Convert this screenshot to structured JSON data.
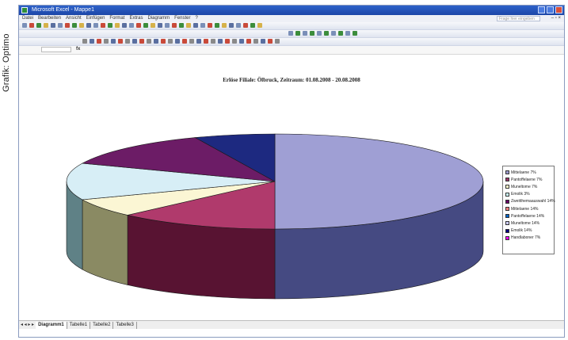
{
  "caption": "Grafik: Optimo",
  "window": {
    "title": "Microsoft Excel - Mappe1"
  },
  "menu": {
    "items": [
      "Datei",
      "Bearbeiten",
      "Ansicht",
      "Einfügen",
      "Format",
      "Extras",
      "Diagramm",
      "Fenster",
      "?"
    ],
    "help_placeholder": "Frage hier eingeben"
  },
  "chart_data": {
    "type": "pie",
    "title": "Erlöse Filiale: Ölbruck, Zeitraum: 01.08.2008 - 20.08.2008",
    "slices": [
      {
        "label": "Mittelaene 7%",
        "value": 7,
        "color": "#9999cc"
      },
      {
        "label": "Pantoffelaene 7%",
        "value": 7,
        "color": "#993366"
      },
      {
        "label": "Muneltome 7%",
        "value": 7,
        "color": "#ffffcc"
      },
      {
        "label": "Emolik 3%",
        "value": 3,
        "color": "#ccffff"
      },
      {
        "label": "Zweitthemaauswahl 14%",
        "value": 14,
        "color": "#660066"
      },
      {
        "label": "Mittelaene 14%",
        "value": 14,
        "color": "#ff8080"
      },
      {
        "label": "Pantoffelaene 14%",
        "value": 14,
        "color": "#0066cc"
      },
      {
        "label": "Muneltome 14%",
        "value": 14,
        "color": "#ccccff"
      },
      {
        "label": "Emolik 14%",
        "value": 14,
        "color": "#000080"
      },
      {
        "label": "Handlaboner 7%",
        "value": 7,
        "color": "#ff00ff"
      }
    ],
    "drawn_slices": [
      {
        "value": 50,
        "top": "#9f9fd4",
        "side": "#454a82"
      },
      {
        "value": 12.5,
        "top": "#b03a6c",
        "side": "#581332"
      },
      {
        "value": 6.25,
        "top": "#fbf6d4",
        "side": "#8a8a63"
      },
      {
        "value": 12.5,
        "top": "#d7eef6",
        "side": "#5f8186"
      },
      {
        "value": 12.5,
        "top": "#6c1c66",
        "side": "#3a0b36"
      },
      {
        "value": 6.25,
        "top": "#1d2980",
        "side": "#0d154d"
      }
    ]
  },
  "sheet_tabs": {
    "nav": "◂ ◂ ▸ ▸",
    "tabs": [
      "Diagramm1",
      "Tabelle1",
      "Tabelle2",
      "Tabelle3"
    ]
  }
}
